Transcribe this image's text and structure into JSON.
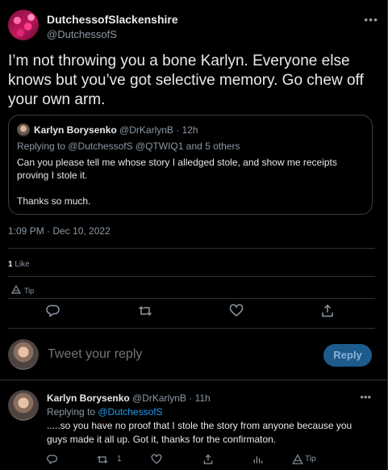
{
  "tweet": {
    "author_name": "DutchessofSlackenshire",
    "author_handle": "@DutchessofS",
    "text": "I’m not throwing you a bone Karlyn.  Everyone else knows but you’ve got selective memory.  Go chew off your own arm.",
    "timestamp": "1:09 PM · Dec 10, 2022",
    "like_count": "1",
    "like_label": " Like",
    "tip_label": "Tip"
  },
  "quote": {
    "author_name": "Karlyn Borysenko",
    "author_meta": "@DrKarlynB · 12h",
    "replying": "Replying to @DutchessofS @QTWIQ1 and 5 others",
    "body_line1": "Can you please tell me whose story I alledged stole, and show me receipts proving I stole it.",
    "body_line2": "Thanks so much."
  },
  "compose": {
    "placeholder": "Tweet your reply",
    "reply_button": "Reply"
  },
  "reply": {
    "author_name": "Karlyn Borysenko",
    "author_meta": "@DrKarlynB · 11h",
    "replying_prefix": "Replying to ",
    "replying_handle": "@DutchessofS",
    "text": ".....so you have no proof that I stole the story from anyone  because you guys made it all up. Got it, thanks for the confirmaton.",
    "retweet_count": "1",
    "tip_label": "Tip"
  },
  "icons": {
    "more": "more-icon",
    "reply": "reply-icon",
    "retweet": "retweet-icon",
    "like": "heart-icon",
    "share": "share-icon",
    "tip": "tip-icon",
    "analytics": "analytics-icon"
  },
  "colors": {
    "background": "#000000",
    "text": "#e7e9ea",
    "muted": "#8b98a5",
    "link": "#1d9bf0",
    "reply_button": "#1d5b8c"
  }
}
